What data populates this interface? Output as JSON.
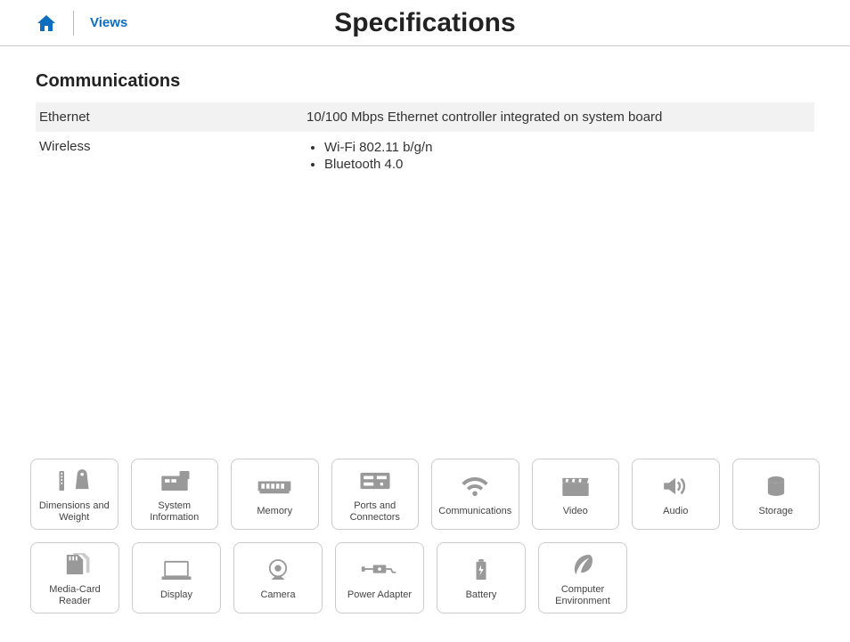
{
  "header": {
    "views_label": "Views",
    "page_title": "Specifications"
  },
  "section": {
    "heading": "Communications",
    "rows": [
      {
        "label": "Ethernet",
        "value": "10/100 Mbps Ethernet controller integrated on system board"
      },
      {
        "label": "Wireless",
        "list": [
          "Wi-Fi 802.11 b/g/n",
          "Bluetooth 4.0"
        ]
      }
    ]
  },
  "nav": {
    "row1": [
      {
        "label": "Dimensions and Weight"
      },
      {
        "label": "System Information"
      },
      {
        "label": "Memory"
      },
      {
        "label": "Ports and Connectors"
      },
      {
        "label": "Communications"
      },
      {
        "label": "Video"
      },
      {
        "label": "Audio"
      },
      {
        "label": "Storage"
      }
    ],
    "row2": [
      {
        "label": "Media-Card Reader"
      },
      {
        "label": "Display"
      },
      {
        "label": "Camera"
      },
      {
        "label": "Power Adapter"
      },
      {
        "label": "Battery"
      },
      {
        "label": "Computer Environment"
      }
    ]
  }
}
